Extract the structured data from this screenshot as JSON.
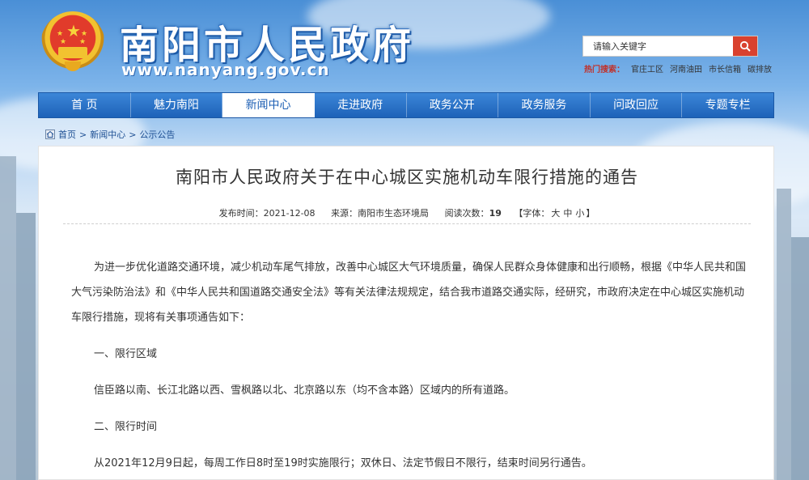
{
  "header": {
    "site_title": "南阳市人民政府",
    "site_url": "www.nanyang.gov.cn",
    "search_placeholder": "请输入关键字",
    "hot_label": "热门搜索：",
    "hot_links": [
      "官庄工区",
      "河南油田",
      "市长信箱",
      "碳排放"
    ]
  },
  "nav": {
    "items": [
      "首 页",
      "魅力南阳",
      "新闻中心",
      "走进政府",
      "政务公开",
      "政务服务",
      "问政回应",
      "专题专栏"
    ],
    "active": "新闻中心"
  },
  "breadcrumb": {
    "items": [
      "首页",
      "新闻中心",
      "公示公告"
    ],
    "separator": ">"
  },
  "article": {
    "title": "南阳市人民政府关于在中心城区实施机动车限行措施的通告",
    "publish_label": "发布时间：",
    "publish_date": "2021-12-08",
    "source_label": "来源：",
    "source": "南阳市生态环境局",
    "reads_label": "阅读次数：",
    "reads": "19",
    "font_label_open": "【字体：",
    "font_sizes": [
      "大",
      "中",
      "小"
    ],
    "font_label_close": "】",
    "paragraphs": [
      "为进一步优化道路交通环境，减少机动车尾气排放，改善中心城区大气环境质量，确保人民群众身体健康和出行顺畅，根据《中华人民共和国大气污染防治法》和《中华人民共和国道路交通安全法》等有关法律法规规定，结合我市道路交通实际，经研究，市政府决定在中心城区实施机动车限行措施，现将有关事项通告如下：",
      "一、限行区域",
      "信臣路以南、长江北路以西、雪枫路以北、北京路以东（均不含本路）区域内的所有道路。",
      "二、限行时间",
      "从2021年12月9日起，每周工作日8时至19时实施限行；双休日、法定节假日不限行，结束时间另行通告。"
    ]
  },
  "colors": {
    "nav_blue": "#1d62b8",
    "search_red": "#d9412e",
    "hot_label_red": "#c0312a",
    "breadcrumb_blue": "#1d4f93"
  }
}
